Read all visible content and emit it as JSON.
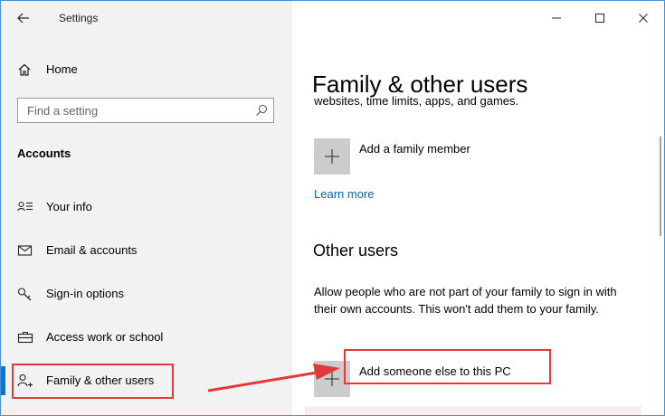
{
  "window": {
    "app_title": "Settings",
    "controls": {
      "minimize": "minimize-icon",
      "maximize": "maximize-icon",
      "close": "close-icon"
    }
  },
  "sidebar": {
    "home_label": "Home",
    "search": {
      "placeholder": "Find a setting",
      "value": ""
    },
    "section": "Accounts",
    "items": [
      {
        "label": "Your info",
        "icon": "person-card-icon"
      },
      {
        "label": "Email & accounts",
        "icon": "mail-icon"
      },
      {
        "label": "Sign-in options",
        "icon": "key-icon"
      },
      {
        "label": "Access work or school",
        "icon": "briefcase-icon"
      },
      {
        "label": "Family & other users",
        "icon": "person-add-icon",
        "active": true
      }
    ]
  },
  "main": {
    "title": "Family & other users",
    "clipped_text": "websites, time limits, apps, and games.",
    "add_family_label": "Add a family member",
    "learn_more": "Learn more",
    "other_users_heading": "Other users",
    "other_users_desc": "Allow people who are not part of your family to sign in with their own accounts. This won't add them to your family.",
    "add_someone_label": "Add someone else to this PC"
  },
  "colors": {
    "accent": "#0078d7",
    "highlight": "#e23a3a",
    "link": "#0067b8"
  }
}
